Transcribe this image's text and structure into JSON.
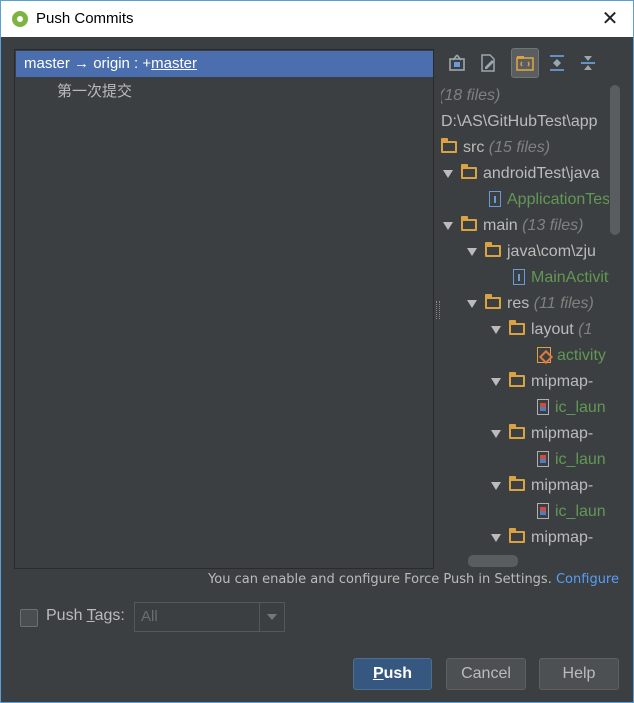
{
  "window": {
    "title": "Push Commits"
  },
  "commits": {
    "branch_local": "master",
    "branch_arrow": "→",
    "branch_remote": "origin : +",
    "branch_target": "master",
    "commit_message": "第一次提交"
  },
  "tree": {
    "rows": [
      {
        "type": "root",
        "count": "(18 files)"
      },
      {
        "type": "path",
        "label": "D:\\AS\\GitHubTest\\app"
      },
      {
        "type": "folder",
        "label": "src",
        "count": "(15 files)"
      },
      {
        "type": "folder",
        "label": "androidTest\\java"
      },
      {
        "type": "file",
        "label": "ApplicationTest"
      },
      {
        "type": "folder",
        "label": "main",
        "count": "(13 files)"
      },
      {
        "type": "folder",
        "label": "java\\com\\zju"
      },
      {
        "type": "file",
        "label": "MainActivity"
      },
      {
        "type": "folder",
        "label": "res",
        "count": "(11 files)"
      },
      {
        "type": "folder",
        "label": "layout",
        "count": "(1"
      },
      {
        "type": "xml",
        "label": "activity"
      },
      {
        "type": "folder",
        "label": "mipmap-"
      },
      {
        "type": "png",
        "label": "ic_laun"
      },
      {
        "type": "folder",
        "label": "mipmap-"
      },
      {
        "type": "png",
        "label": "ic_laun"
      },
      {
        "type": "folder",
        "label": "mipmap-"
      },
      {
        "type": "png",
        "label": "ic_laun"
      },
      {
        "type": "folder",
        "label": "mipmap-"
      }
    ]
  },
  "hint": {
    "text": "You can enable and configure Force Push in Settings.",
    "link": "Configure"
  },
  "tags": {
    "label_pre": "Push ",
    "label_mnemonic": "T",
    "label_post": "ags:",
    "selected": "All"
  },
  "buttons": {
    "push_mnemonic": "P",
    "push_rest": "ush",
    "cancel": "Cancel",
    "help": "Help"
  },
  "colors": {
    "background": "#3c3f41",
    "selection": "#4b6eaf",
    "primary_button": "#365880",
    "link": "#589df6",
    "file_green": "#629755",
    "folder": "#d9a343"
  }
}
